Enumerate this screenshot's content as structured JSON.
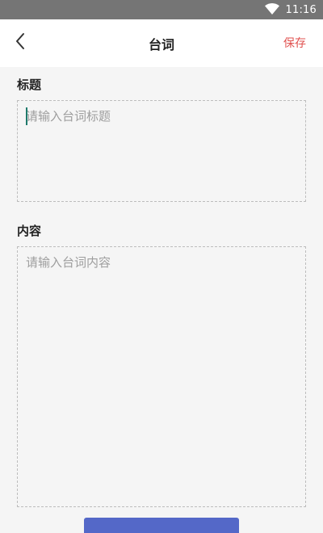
{
  "status_bar": {
    "time": "11:16",
    "wifi_icon": "wifi-icon"
  },
  "header": {
    "back_icon": "chevron-left-icon",
    "title": "台词",
    "save_label": "保存"
  },
  "form": {
    "title_label": "标题",
    "title_placeholder": "请输入台词标题",
    "title_value": "",
    "content_label": "内容",
    "content_placeholder": "请输入台词内容",
    "content_value": ""
  },
  "colors": {
    "accent": "#e0514f",
    "button": "#5468c8",
    "status_bar": "#757575"
  }
}
